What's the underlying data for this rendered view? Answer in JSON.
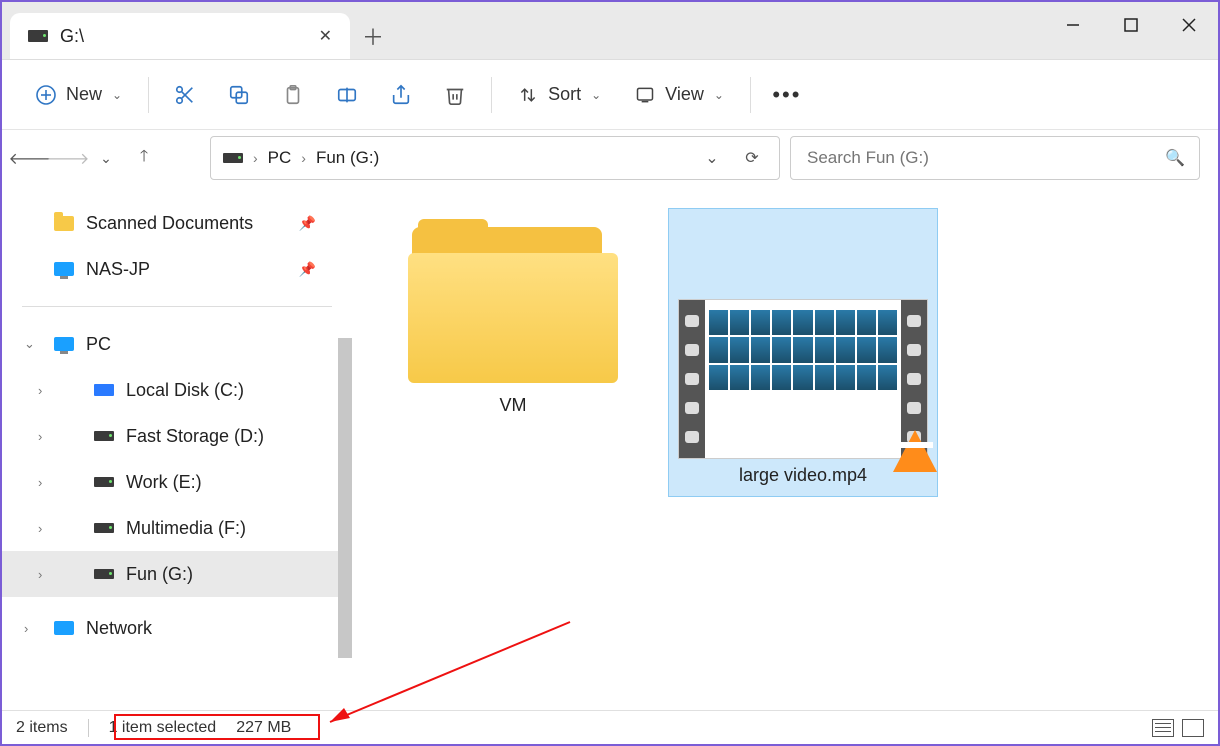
{
  "tab": {
    "title": "G:\\"
  },
  "toolbar": {
    "new": "New",
    "sort": "Sort",
    "view": "View"
  },
  "breadcrumb": {
    "root": "PC",
    "drive": "Fun (G:)"
  },
  "search": {
    "placeholder": "Search Fun (G:)"
  },
  "sidebar": {
    "pinned": [
      {
        "label": "Scanned Documents"
      },
      {
        "label": "NAS-JP"
      }
    ],
    "pc_label": "PC",
    "drives": [
      {
        "label": "Local Disk (C:)"
      },
      {
        "label": "Fast Storage (D:)"
      },
      {
        "label": "Work (E:)"
      },
      {
        "label": "Multimedia (F:)"
      },
      {
        "label": "Fun (G:)"
      }
    ],
    "network_label": "Network"
  },
  "items": {
    "folder": {
      "label": "VM"
    },
    "video": {
      "label": "large video.mp4"
    }
  },
  "status": {
    "count": "2 items",
    "selection": "1 item selected",
    "size": "227 MB"
  }
}
